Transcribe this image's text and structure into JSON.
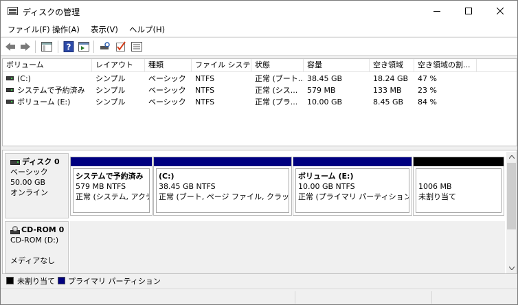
{
  "window": {
    "title": "ディスクの管理"
  },
  "menu": {
    "file": "ファイル(F)",
    "action": "操作(A)",
    "view": "表示(V)",
    "help": "ヘルプ(H)"
  },
  "toolbar": {
    "icons": [
      "back-arrow-icon",
      "forward-arrow-icon",
      "console-tree-icon",
      "help-icon",
      "properties-icon",
      "rescan-icon",
      "check-icon",
      "list-view-icon"
    ]
  },
  "volume_list": {
    "headers": [
      "ボリューム",
      "レイアウト",
      "種類",
      "ファイル システム",
      "状態",
      "容量",
      "空き領域",
      "空き領域の割..."
    ],
    "rows": [
      [
        "(C:)",
        "シンプル",
        "ベーシック",
        "NTFS",
        "正常 (ブート...",
        "38.45 GB",
        "18.24 GB",
        "47 %"
      ],
      [
        "システムで予約済み",
        "シンプル",
        "ベーシック",
        "NTFS",
        "正常 (シス...",
        "579 MB",
        "133 MB",
        "23 %"
      ],
      [
        "ボリューム (E:)",
        "シンプル",
        "ベーシック",
        "NTFS",
        "正常 (プラ...",
        "10.00 GB",
        "8.45 GB",
        "84 %"
      ]
    ]
  },
  "disks": [
    {
      "name": "ディスク 0",
      "type": "ベーシック",
      "size": "50.00 GB",
      "status": "オンライン",
      "partitions": [
        {
          "name": "システムで予約済み",
          "size": "579 MB NTFS",
          "status": "正常 (システム, アクティ",
          "bar": "#000080"
        },
        {
          "name": "(C:)",
          "size": "38.45 GB NTFS",
          "status": "正常 (ブート, ページ ファイル, クラッシュ ダ",
          "bar": "#000080"
        },
        {
          "name": "ボリューム  (E:)",
          "size": "10.00 GB NTFS",
          "status": "正常 (プライマリ パーティション)",
          "bar": "#000080"
        },
        {
          "name": "",
          "size": "1006 MB",
          "status": "未割り当て",
          "bar": "#000000"
        }
      ]
    }
  ],
  "cdrom": {
    "name": "CD-ROM 0",
    "drive": "CD-ROM (D:)",
    "media": "メディアなし"
  },
  "legend": {
    "unallocated": "未割り当て",
    "primary": "プライマリ パーティション",
    "unallocated_color": "#000000",
    "primary_color": "#000080"
  }
}
